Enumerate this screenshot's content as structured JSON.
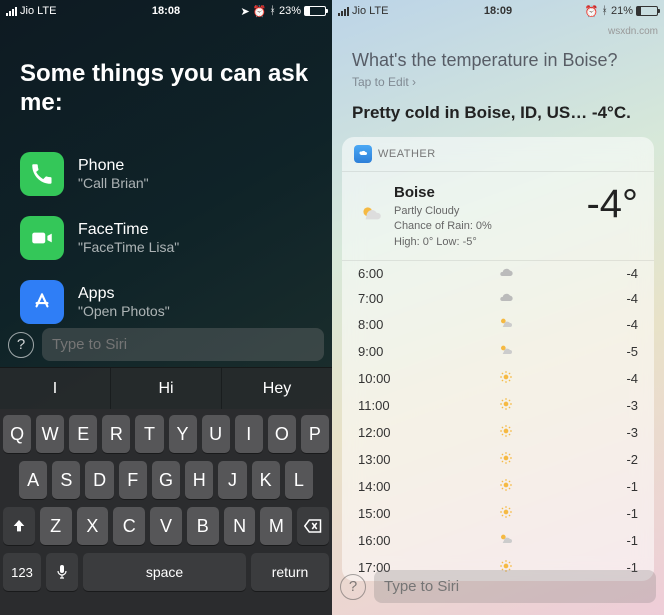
{
  "left": {
    "status": {
      "carrier": "Jio",
      "net": "LTE",
      "time": "18:08",
      "batt_pct": "23%",
      "batt_fill": 23
    },
    "heading": "Some things you can ask me:",
    "suggestions": [
      {
        "icon": "phone",
        "color": "#34c759",
        "title": "Phone",
        "sub": "\"Call Brian\""
      },
      {
        "icon": "facetime",
        "color": "#34c759",
        "title": "FaceTime",
        "sub": "\"FaceTime Lisa\""
      },
      {
        "icon": "apps",
        "color": "#2f7ef6",
        "title": "Apps",
        "sub": "\"Open Photos\""
      }
    ],
    "input_placeholder": "Type to Siri",
    "predictions": [
      "I",
      "Hi",
      "Hey"
    ],
    "keyboard": {
      "r1": [
        "Q",
        "W",
        "E",
        "R",
        "T",
        "Y",
        "U",
        "I",
        "O",
        "P"
      ],
      "r2": [
        "A",
        "S",
        "D",
        "F",
        "G",
        "H",
        "J",
        "K",
        "L"
      ],
      "r3": [
        "Z",
        "X",
        "C",
        "V",
        "B",
        "N",
        "M"
      ],
      "num": "123",
      "space": "space",
      "ret": "return"
    }
  },
  "right": {
    "status": {
      "carrier": "Jio",
      "net": "LTE",
      "time": "18:09",
      "batt_pct": "21%",
      "batt_fill": 21
    },
    "query": "What's the temperature in Boise?",
    "tap": "Tap to Edit ›",
    "answer": "Pretty cold in Boise, ID, US… -4°C.",
    "card_label": "WEATHER",
    "now": {
      "loc": "Boise",
      "cond": "Partly Cloudy",
      "rain": "Chance of Rain: 0%",
      "hilo": "High: 0° Low: -5°",
      "temp": "-4°"
    },
    "hours": [
      {
        "h": "6:00",
        "icon": "cloud",
        "v": "-4"
      },
      {
        "h": "7:00",
        "icon": "cloud",
        "v": "-4"
      },
      {
        "h": "8:00",
        "icon": "partly",
        "v": "-4"
      },
      {
        "h": "9:00",
        "icon": "partly",
        "v": "-5"
      },
      {
        "h": "10:00",
        "icon": "sun",
        "v": "-4"
      },
      {
        "h": "11:00",
        "icon": "sun",
        "v": "-3"
      },
      {
        "h": "12:00",
        "icon": "sun",
        "v": "-3"
      },
      {
        "h": "13:00",
        "icon": "sun",
        "v": "-2"
      },
      {
        "h": "14:00",
        "icon": "sun",
        "v": "-1"
      },
      {
        "h": "15:00",
        "icon": "sun",
        "v": "-1"
      },
      {
        "h": "16:00",
        "icon": "partly",
        "v": "-1"
      },
      {
        "h": "17:00",
        "icon": "sun",
        "v": "-1"
      }
    ],
    "input_placeholder": "Type to Siri"
  },
  "watermark": "wsxdn.com"
}
